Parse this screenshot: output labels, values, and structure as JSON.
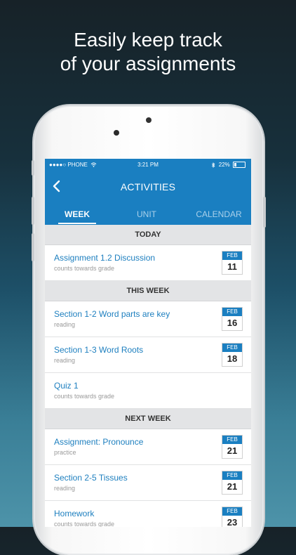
{
  "promo": {
    "line1": "Easily keep track",
    "line2": "of your assignments"
  },
  "status_bar": {
    "signal": "●●●●○ PHONE",
    "time": "3:21 PM",
    "battery": "22%",
    "battery_level": 0.22
  },
  "header": {
    "title": "ACTIVITIES",
    "back_icon": "chevron-left-icon"
  },
  "tabs": [
    {
      "label": "WEEK",
      "active": true
    },
    {
      "label": "UNIT",
      "active": false
    },
    {
      "label": "CALENDAR",
      "active": false
    }
  ],
  "sections": [
    {
      "label": "TODAY",
      "items": [
        {
          "title": "Assignment 1.2 Discussion",
          "subtitle": "counts towards grade",
          "month": "FEB",
          "day": "11"
        }
      ]
    },
    {
      "label": "THIS WEEK",
      "items": [
        {
          "title": "Section 1-2 Word parts are key",
          "subtitle": "reading",
          "month": "FEB",
          "day": "16"
        },
        {
          "title": "Section 1-3 Word Roots",
          "subtitle": "reading",
          "month": "FEB",
          "day": "18"
        },
        {
          "title": "Quiz 1",
          "subtitle": "counts towards grade",
          "month": "",
          "day": ""
        }
      ]
    },
    {
      "label": "NEXT WEEK",
      "items": [
        {
          "title": "Assignment: Pronounce",
          "subtitle": "practice",
          "month": "FEB",
          "day": "21"
        },
        {
          "title": "Section 2-5 Tissues",
          "subtitle": "reading",
          "month": "FEB",
          "day": "21"
        },
        {
          "title": "Homework",
          "subtitle": "counts towards grade",
          "month": "FEB",
          "day": "23"
        }
      ]
    }
  ],
  "colors": {
    "accent": "#1a7fc1",
    "section_bg": "#e3e4e6"
  }
}
